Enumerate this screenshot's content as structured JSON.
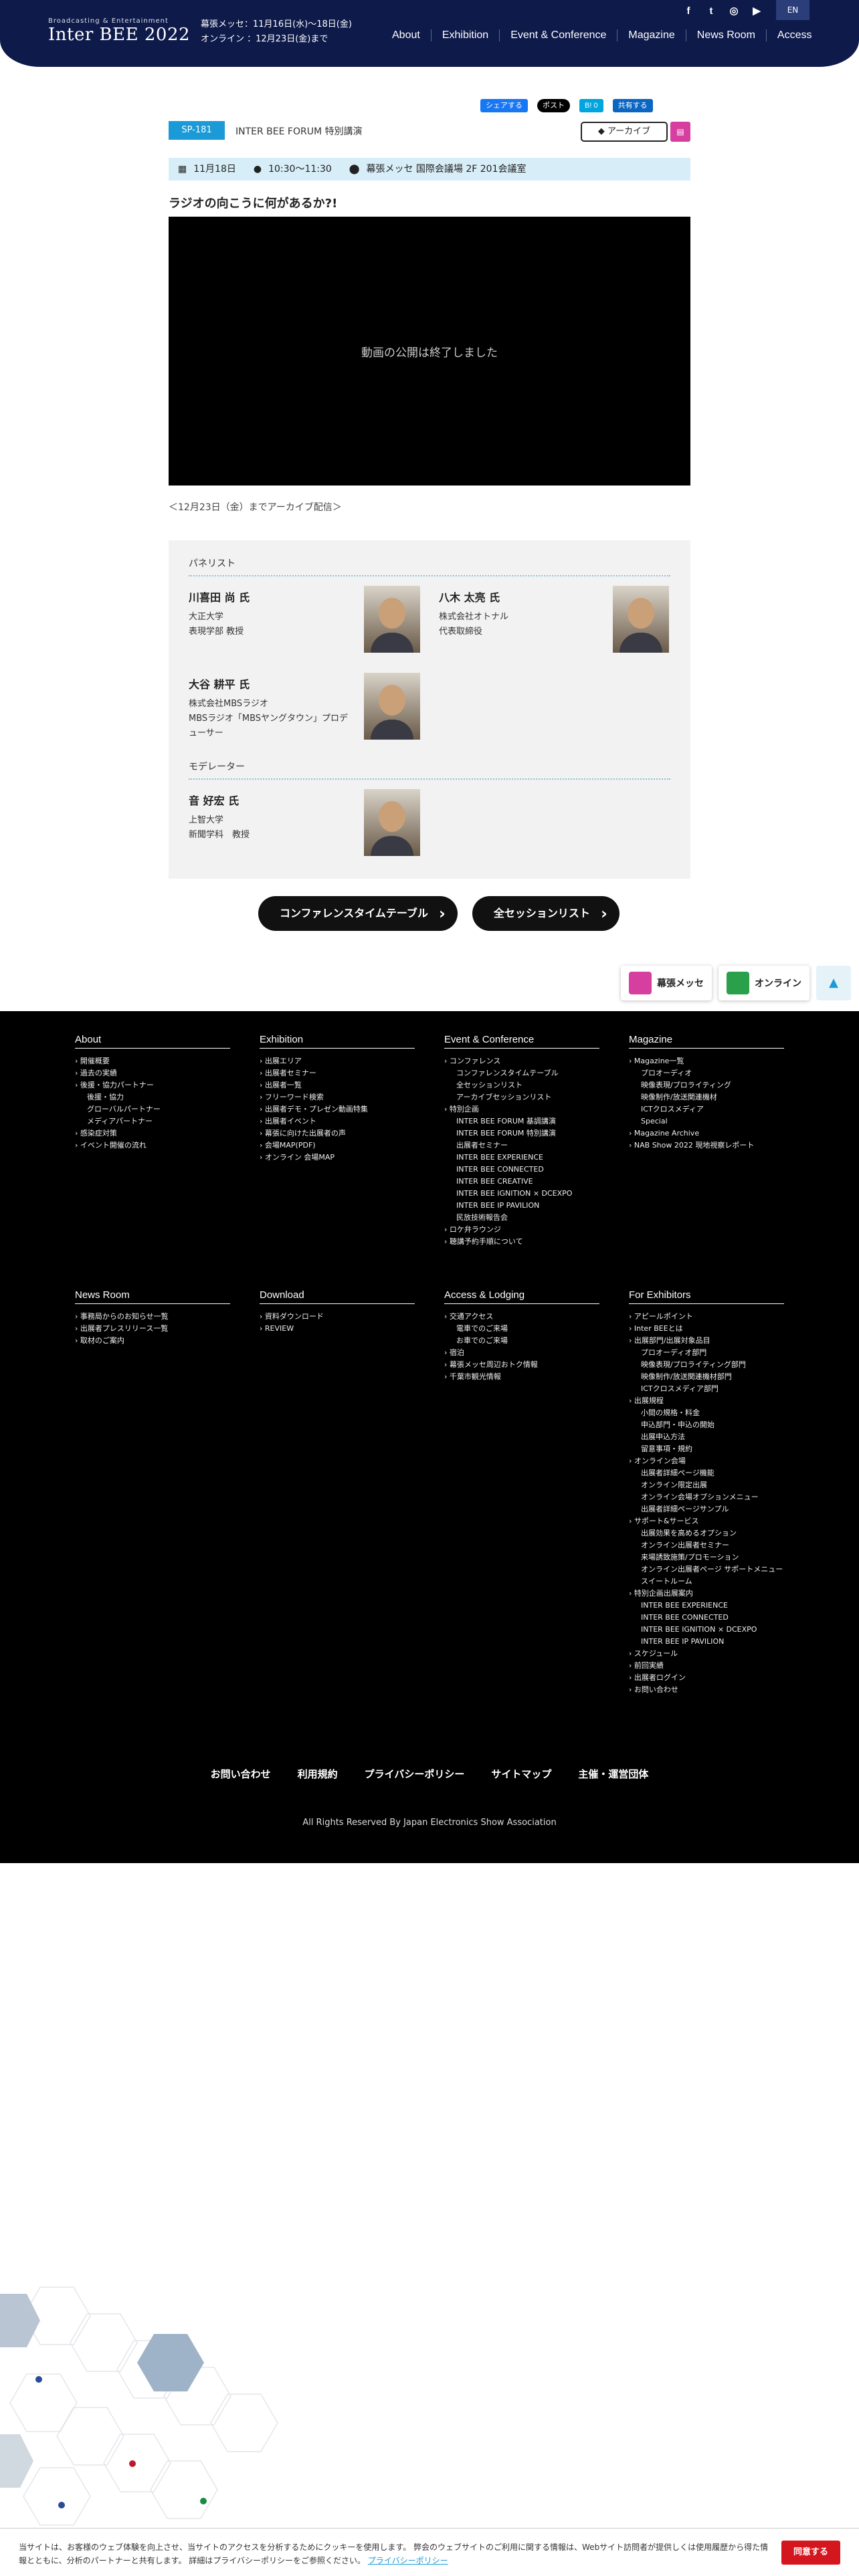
{
  "header": {
    "logo_small": "Broadcasting & Entertainment",
    "logo": "Inter BEE 2022",
    "venue_line": "幕張メッセ：11月16日(水)〜18日(金)",
    "online_line": "オンライン ：12月23日(金)まで",
    "nav": [
      "About",
      "Exhibition",
      "Event & Conference",
      "Magazine",
      "News Room",
      "Access"
    ],
    "lang": "EN"
  },
  "share": {
    "facebook": "シェアする",
    "x": "ポスト",
    "hatena": "B! 0",
    "linkedin": "共有する"
  },
  "session": {
    "code": "SP-181",
    "category": "INTER BEE FORUM 特別講演",
    "archive_label": "アーカイブ",
    "archive_icon": "",
    "date": "11月18日",
    "time": "10:30〜11:30",
    "place": "幕張メッセ 国際会議場 2F 201会議室",
    "title": "ラジオの向こうに何があるか?!",
    "video_message": "動画の公開は終了しました",
    "archive_note": "＜12月23日（金）までアーカイブ配信＞"
  },
  "speakers": {
    "panelist_label": "パネリスト",
    "moderator_label": "モデレーター",
    "panelists": [
      {
        "name": "川喜田 尚 氏",
        "aff": [
          "大正大学",
          "表現学部 教授"
        ]
      },
      {
        "name": "八木 太亮 氏",
        "aff": [
          "株式会社オトナル",
          "代表取締役"
        ]
      },
      {
        "name": "大谷 耕平 氏",
        "aff": [
          "株式会社MBSラジオ",
          "MBSラジオ「MBSヤングタウン」プロデューサー"
        ]
      }
    ],
    "moderator": {
      "name": "音 好宏 氏",
      "aff": [
        "上智大学",
        "新聞学科　教授"
      ]
    }
  },
  "buttons": {
    "timetable": "コンファレンスタイムテーブル",
    "sessions": "全セッションリスト"
  },
  "float": {
    "makuhari": "幕張メッセ",
    "online": "オンライン",
    "top": "▲"
  },
  "footer": {
    "about": {
      "title": "About",
      "links": [
        "開催概要",
        "過去の実績",
        "後援・協力パートナー",
        "~後援・協力",
        "~グローバルパートナー",
        "~メディアパートナー",
        "感染症対策",
        "イベント開催の流れ"
      ]
    },
    "exhibition": {
      "title": "Exhibition",
      "links": [
        "出展エリア",
        "出展者セミナー",
        "出展者一覧",
        "フリーワード検索",
        "出展者デモ・プレゼン動画特集",
        "出展者イベント",
        "幕張に向けた出展者の声",
        "会場MAP(PDF)",
        "オンライン 会場MAP"
      ]
    },
    "event": {
      "title": "Event & Conference",
      "links": [
        "コンファレンス",
        "~コンファレンスタイムテーブル",
        "~全セッションリスト",
        "~アーカイブセッションリスト",
        "特別企画",
        "~INTER BEE FORUM 基調講演",
        "~INTER BEE FORUM 特別講演",
        "~出展者セミナー",
        "~INTER BEE EXPERIENCE",
        "~INTER BEE CONNECTED",
        "~INTER BEE CREATIVE",
        "~INTER BEE IGNITION × DCEXPO",
        "~INTER BEE IP PAVILION",
        "~民放技術報告会",
        "ロケ弁ラウンジ",
        "聴講予約手順について"
      ]
    },
    "magazine": {
      "title": "Magazine",
      "links": [
        "Magazine一覧",
        "~プロオーディオ",
        "~映像表現/プロライティング",
        "~映像制作/放送関連機材",
        "~ICTクロスメディア",
        "~Special",
        "Magazine Archive",
        "NAB Show 2022 現地視察レポート"
      ]
    },
    "news": {
      "title": "News Room",
      "links": [
        "事務局からのお知らせ一覧",
        "出展者プレスリリース一覧",
        "取材のご案内"
      ]
    },
    "download": {
      "title": "Download",
      "links": [
        "資料ダウンロード",
        "REVIEW"
      ]
    },
    "access": {
      "title": "Access & Lodging",
      "links": [
        "交通アクセス",
        "~電車でのご来場",
        "~お車でのご来場",
        "宿泊",
        "幕張メッセ周辺おトク情報",
        "千葉市観光情報"
      ]
    },
    "exhibitors": {
      "title": "For Exhibitors",
      "links": [
        "アピールポイント",
        "Inter BEEとは",
        "出展部門/出展対象品目",
        "~プロオーディオ部門",
        "~映像表現/プロライティング部門",
        "~映像制作/放送関連機材部門",
        "~ICTクロスメディア部門",
        "出展規程",
        "~小間の規格・料金",
        "~申込部門・申込の開始",
        "~出展申込方法",
        "~留意事項・規約",
        "オンライン会場",
        "~出展者詳細ページ機能",
        "~オンライン限定出展",
        "~オンライン会場オプションメニュー",
        "~出展者詳細ページサンプル",
        "サポート&サービス",
        "~出展効果を高めるオプション",
        "~オンライン出展者セミナー",
        "~来場誘致施策/プロモーション",
        "~オンライン出展者ページ サポートメニュー",
        "~スイートルーム",
        "特別企画出展案内",
        "~INTER BEE EXPERIENCE",
        "~INTER BEE CONNECTED",
        "~INTER BEE IGNITION × DCEXPO",
        "~INTER BEE IP PAVILION",
        "スケジュール",
        "前回実績",
        "出展者ログイン",
        "お問い合わせ"
      ]
    },
    "bottom_links": [
      "お問い合わせ",
      "利用規約",
      "プライバシーポリシー",
      "サイトマップ",
      "主催・運営団体"
    ],
    "copyright": "All Rights Reserved By Japan Electronics Show Association"
  },
  "cookie": {
    "text": "当サイトは、お客様のウェブ体験を向上させ、当サイトのアクセスを分析するためにクッキーを使用します。 弊会のウェブサイトのご利用に関する情報は、Webサイト訪問者が提供しくは使用履歴から得た情報とともに、分析のパートナーと共有します。 詳細はプライバシーポリシーをご参照ください。",
    "link": "プライバシーポリシー",
    "agree": "同意する"
  },
  "colors": {
    "navy": "#0e1a4a",
    "accent": "#1a9ad6",
    "agree": "#d4171f"
  }
}
